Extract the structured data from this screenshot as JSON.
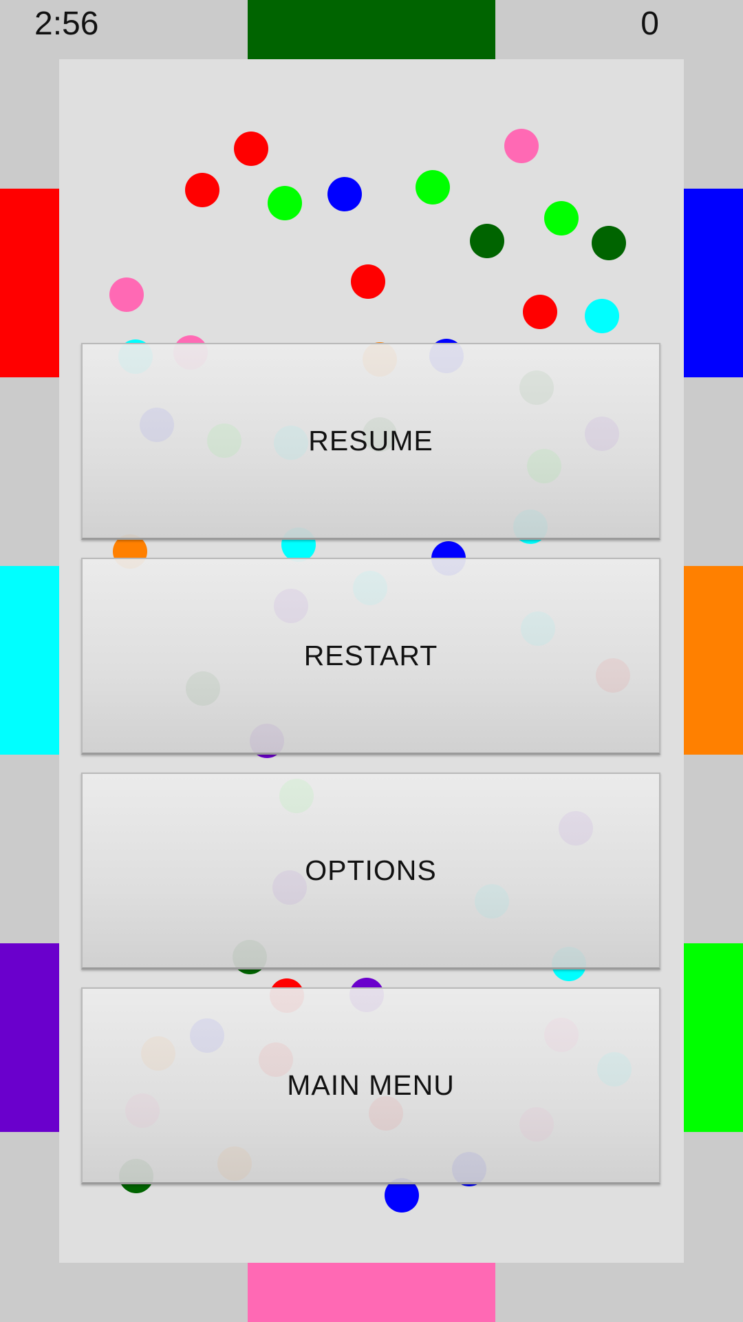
{
  "hud": {
    "timer": "2:56",
    "score": "0"
  },
  "colors": {
    "background": "#cbcbcb",
    "arena": "#dfdfdf",
    "red": "#ff0000",
    "blue": "#0000ff",
    "green": "#00ff00",
    "dark_green": "#006400",
    "pink": "#ff69b4",
    "cyan": "#00ffff",
    "orange": "#ff8000",
    "purple": "#6a00cc"
  },
  "goals": {
    "top": "dark_green",
    "bottom": "pink",
    "left": [
      "red",
      "cyan",
      "purple"
    ],
    "right": [
      "blue",
      "orange",
      "green"
    ]
  },
  "balls_colors_top_area": [
    "red",
    "red",
    "green",
    "blue",
    "green",
    "pink",
    "dark_green",
    "green",
    "dark_green",
    "pink",
    "red",
    "red",
    "cyan"
  ],
  "pause_menu": {
    "resume_label": "RESUME",
    "restart_label": "RESTART",
    "options_label": "OPTIONS",
    "main_menu_label": "MAIN MENU"
  }
}
